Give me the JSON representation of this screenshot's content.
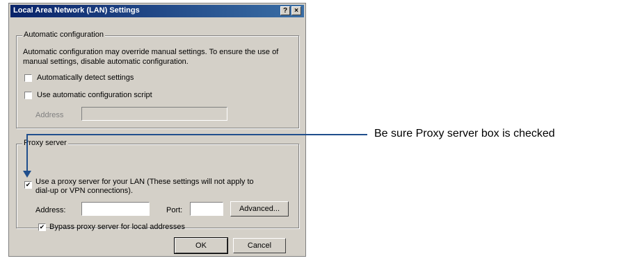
{
  "dialog": {
    "title": "Local Area Network (LAN) Settings",
    "help_glyph": "?",
    "close_glyph": "×"
  },
  "auto_config": {
    "group_label": "Automatic configuration",
    "description_line1": "Automatic configuration may override manual settings. To ensure the use of",
    "description_line2": "manual settings, disable automatic configuration.",
    "detect_label": "Automatically detect settings",
    "detect_checked": false,
    "script_label": "Use automatic configuration script",
    "script_checked": false,
    "address_label": "Address",
    "address_value": ""
  },
  "proxy": {
    "group_label": "Proxy server",
    "use_proxy_label_line1": "Use a proxy server for your LAN (These settings will not apply to",
    "use_proxy_label_line2": "dial-up or VPN connections).",
    "use_proxy_checked": true,
    "check_mark": "✔",
    "address_label": "Address:",
    "address_value": "",
    "port_label": "Port:",
    "port_value": "",
    "advanced_label": "Advanced...",
    "bypass_label": "Bypass proxy server for local addresses",
    "bypass_checked": true
  },
  "buttons": {
    "ok_label": "OK",
    "cancel_label": "Cancel"
  },
  "callout": {
    "text": "Be sure Proxy server box is checked",
    "color": "#1f4e8c"
  }
}
